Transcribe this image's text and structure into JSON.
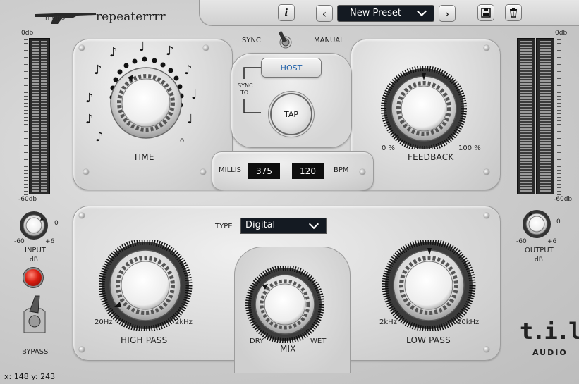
{
  "brand": {
    "mono": "mono",
    "name": "repeaterrrr"
  },
  "toolbar": {
    "info_label": "i",
    "prev_symbol": "‹",
    "next_symbol": "›",
    "preset_name": "New Preset"
  },
  "sync": {
    "left": "SYNC",
    "right": "MANUAL",
    "sync_to": [
      "SYNC",
      "TO"
    ],
    "host_label": "HOST",
    "tap_label": "TAP"
  },
  "time": {
    "label": "TIME"
  },
  "feedback": {
    "label": "FEEDBACK",
    "min": "0 %",
    "max": "100 %"
  },
  "readouts": {
    "millis_label": "MILLIS",
    "millis_value": "375",
    "bpm_value": "120",
    "bpm_label": "BPM"
  },
  "type": {
    "label": "TYPE",
    "value": "Digital"
  },
  "highpass": {
    "label": "HIGH PASS",
    "min": "20Hz",
    "max": "2kHz"
  },
  "mix": {
    "label": "MIX",
    "min": "DRY",
    "max": "WET"
  },
  "lowpass": {
    "label": "LOW PASS",
    "min": "2kHz",
    "max": "20kHz"
  },
  "input": {
    "label": "INPUT",
    "unit": "dB",
    "min": "-60",
    "mid": "0",
    "max": "+6"
  },
  "output": {
    "label": "OUTPUT",
    "unit": "dB",
    "min": "-60",
    "mid": "0",
    "max": "+6"
  },
  "meters": {
    "top": "0db",
    "bottom": "-60db"
  },
  "bypass": {
    "label": "BYPASS"
  },
  "logo": {
    "line1": "t.i.l.t",
    "line2": "AUDIO"
  },
  "status": {
    "text": "x: 148 y: 243"
  },
  "colors": {
    "accent": "#1d5fa8",
    "led": "#d91d10",
    "display_bg": "#141a22"
  }
}
